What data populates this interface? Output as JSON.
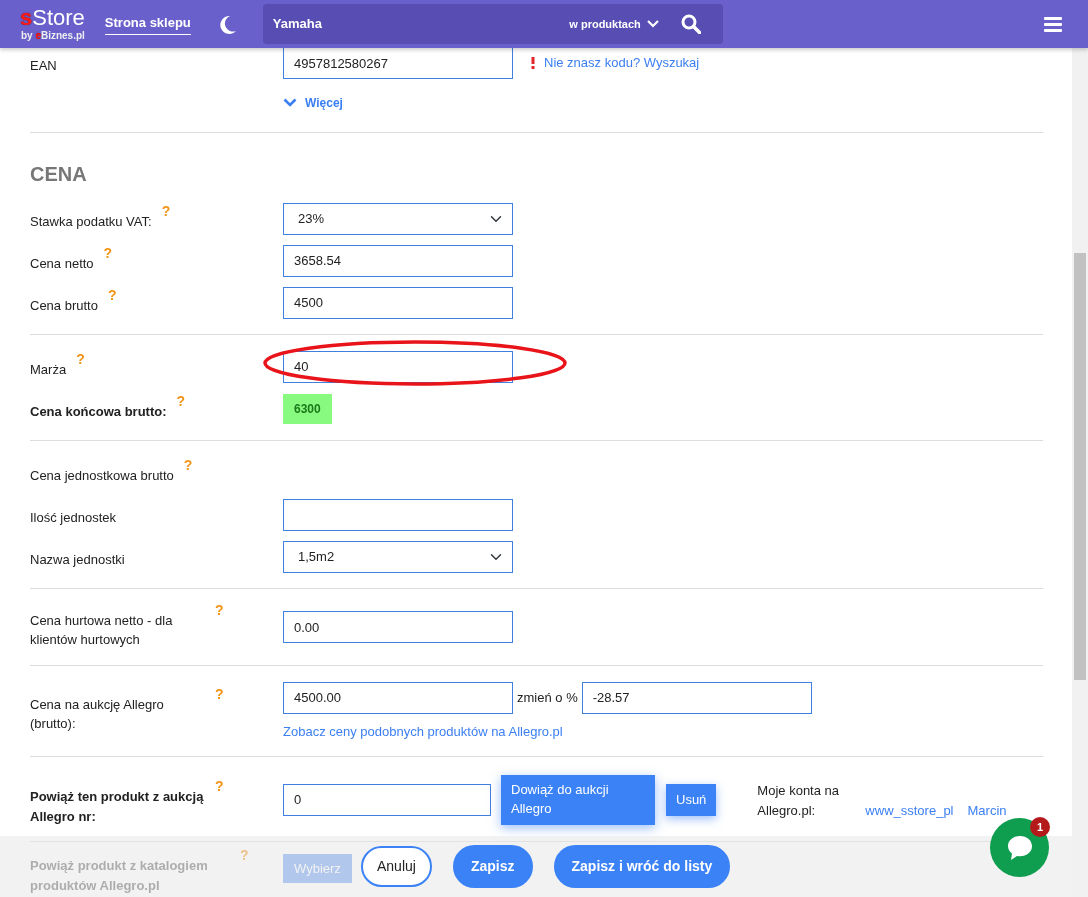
{
  "navbar": {
    "logo": {
      "accent": "s",
      "text": "Store"
    },
    "byline": {
      "prefix": "by ",
      "accent": "e",
      "text": "Biznes.pl"
    },
    "shop_link": "Strona sklepu",
    "search": {
      "value": "Yamaha",
      "scope": "w produktach"
    }
  },
  "form": {
    "groups": [
      {
        "rows": [
          {
            "kind": "input",
            "label": "EAN",
            "value": "4957812580267",
            "hint_link": "Nie znasz kodu? Wyszukaj"
          }
        ],
        "more": "Więcej"
      },
      {
        "title": "CENA",
        "rows": [
          {
            "kind": "select",
            "label": "Stawka podatku VAT:",
            "help": "?",
            "value": "23%"
          },
          {
            "kind": "input",
            "label": "Cena netto",
            "help": "?",
            "value": "3658.54"
          },
          {
            "kind": "input",
            "label": "Cena brutto",
            "help": "?",
            "value": "4500"
          }
        ]
      },
      {
        "rows": [
          {
            "kind": "input",
            "label": "Marża",
            "help": "?",
            "value": "40",
            "highlighted": true
          },
          {
            "kind": "output",
            "label": "Cena końcowa brutto:",
            "bold": true,
            "help": "?",
            "value": "6300"
          }
        ]
      },
      {
        "rows": [
          {
            "kind": "text",
            "label": "Cena jednostkowa brutto",
            "help": "?"
          },
          {
            "kind": "input",
            "label": "Ilość jednostek"
          },
          {
            "kind": "select",
            "label": "Nazwa jednostki",
            "value": "1,5m2"
          }
        ]
      },
      {
        "rows": [
          {
            "kind": "input",
            "label": "Cena hurtowa netto - dla klientów hurtowych",
            "help": "?",
            "value": "0.00"
          }
        ]
      },
      {
        "rows": [
          {
            "kind": "pair",
            "label": "Cena na aukcję Allegro (brutto):",
            "help": "?",
            "value": "4500.00",
            "extra_label": "zmień o %",
            "extra_value": "-28.57",
            "link": "Zobacz ceny podobnych produktów na Allegro.pl"
          }
        ]
      },
      {
        "rows": [
          {
            "kind": "bind",
            "label": "Powiąż ten produkt z aukcją Allegro nr:",
            "bold": true,
            "help": "?",
            "value": "0",
            "buttons": [
              "Dowiąż do aukcji Allegro",
              "Usuń"
            ],
            "accounts": {
              "label": "Moje konta na Allegro.pl:",
              "links": [
                "www_sstore_pl",
                "Marcin"
              ]
            }
          }
        ]
      },
      {
        "rows": [
          {
            "kind": "catalog",
            "label": "Powiąż produkt z katalogiem produktów Allegro.pl",
            "bold": true,
            "help": "?",
            "buttons": [
              "Wybierz"
            ]
          }
        ]
      }
    ]
  },
  "footer": {
    "buttons": [
      {
        "label": "Anuluj",
        "kind": "outline"
      },
      {
        "label": "Zapisz",
        "kind": "primary"
      },
      {
        "label": "Zapisz i wróć do listy",
        "kind": "primary"
      }
    ]
  },
  "chat": {
    "badge": "1"
  }
}
